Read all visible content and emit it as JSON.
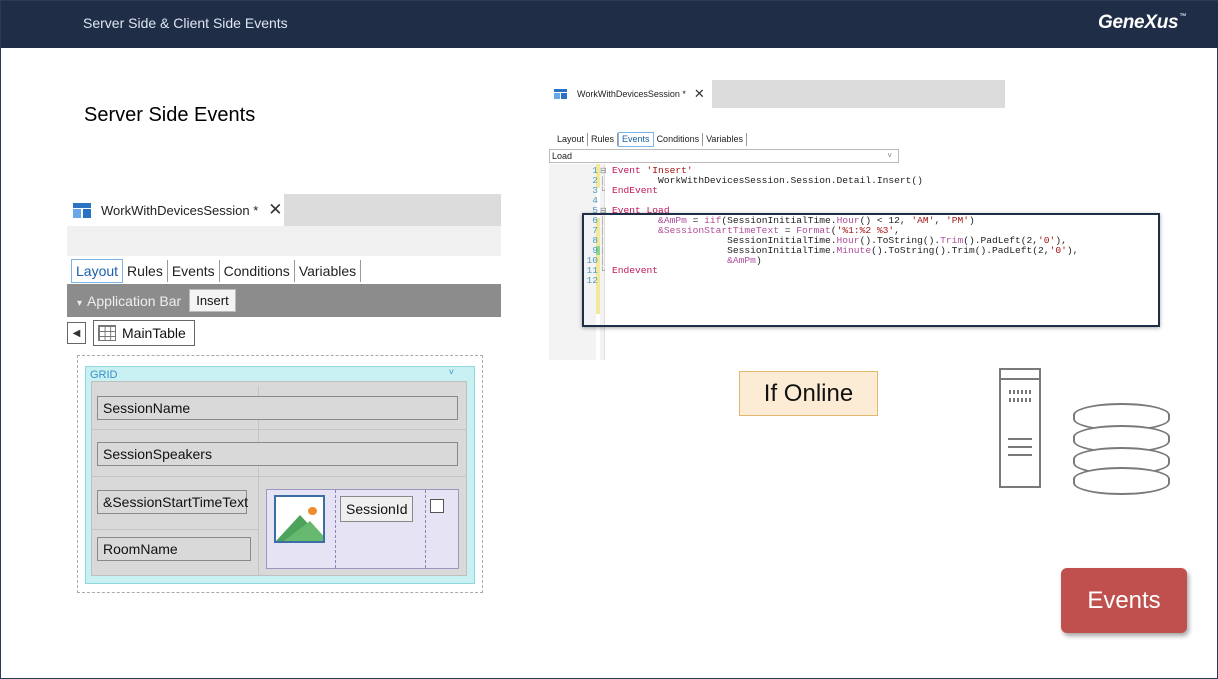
{
  "slide": {
    "header_title": "Server Side & Client Side Events",
    "logo_text": "GeneXus",
    "logo_mark": "™",
    "heading": "Server Side Events",
    "if_online_label": "If Online",
    "events_badge": "Events",
    "colors": {
      "header_bg": "#1f2d47",
      "badge_bg": "#c0504d",
      "note_bg": "#fcecd6"
    }
  },
  "layout_editor": {
    "doc_tab": "WorkWithDevicesSession *",
    "close_glyph": "✕",
    "tabs": [
      "Layout",
      "Rules",
      "Events",
      "Conditions",
      "Variables"
    ],
    "active_tab": "Layout",
    "application_bar_label": "Application Bar",
    "application_bar_caret": "▾",
    "insert_button": "Insert",
    "back_glyph": "◀",
    "breadcrumb": "MainTable",
    "grid_label": "GRID",
    "grid_caret": "˅",
    "fields": {
      "session_name": "SessionName",
      "session_speakers": "SessionSpeakers",
      "start_time_text": "&SessionStartTimeText",
      "room_name": "RoomName",
      "session_id": "SessionId"
    }
  },
  "events_editor": {
    "doc_tab": "WorkWithDevicesSession *",
    "close_glyph": "✕",
    "tabs": [
      "Layout",
      "Rules",
      "Events",
      "Conditions",
      "Variables"
    ],
    "active_tab": "Events",
    "event_dropdown_value": "Load",
    "dropdown_caret": "˅",
    "code_lines": [
      {
        "n": "1",
        "fold": "⊟",
        "parts": [
          [
            "kw",
            "Event "
          ],
          [
            "str",
            "'Insert'"
          ]
        ]
      },
      {
        "n": "2",
        "fold": "│",
        "parts": [
          [
            "txt",
            "        WorkWithDevicesSession.Session.Detail.Insert()"
          ]
        ]
      },
      {
        "n": "3",
        "fold": "└",
        "parts": [
          [
            "kw",
            "EndEvent"
          ]
        ]
      },
      {
        "n": "4",
        "fold": "",
        "parts": []
      },
      {
        "n": "5",
        "fold": "⊟",
        "parts": [
          [
            "kw",
            "Event "
          ],
          [
            "kw",
            "Load"
          ]
        ]
      },
      {
        "n": "6",
        "fold": "│",
        "parts": [
          [
            "var",
            "        &AmPm"
          ],
          [
            "txt",
            " = "
          ],
          [
            "fn",
            "iif"
          ],
          [
            "txt",
            "(SessionInitialTime."
          ],
          [
            "fn",
            "Hour"
          ],
          [
            "txt",
            "() < 12, "
          ],
          [
            "str",
            "'AM'"
          ],
          [
            "txt",
            ", "
          ],
          [
            "str",
            "'PM'"
          ],
          [
            "txt",
            ")"
          ]
        ]
      },
      {
        "n": "7",
        "fold": "│",
        "parts": [
          [
            "var",
            "        &SessionStartTimeText"
          ],
          [
            "txt",
            " = "
          ],
          [
            "fn",
            "Format"
          ],
          [
            "txt",
            "("
          ],
          [
            "str",
            "'%1:%2 %3'"
          ],
          [
            "txt",
            ","
          ]
        ]
      },
      {
        "n": "8",
        "fold": "│",
        "parts": [
          [
            "txt",
            "                    SessionInitialTime."
          ],
          [
            "fn",
            "Hour"
          ],
          [
            "txt",
            "().ToString()."
          ],
          [
            "fn",
            "Trim"
          ],
          [
            "txt",
            "().PadLeft(2,"
          ],
          [
            "str",
            "'0'"
          ],
          [
            "txt",
            "),"
          ]
        ]
      },
      {
        "n": "9",
        "fold": "│",
        "parts": [
          [
            "txt",
            "                    SessionInitialTime."
          ],
          [
            "fn",
            "Minute"
          ],
          [
            "txt",
            "().ToString().Trim().PadLeft(2,"
          ],
          [
            "str",
            "'0'"
          ],
          [
            "txt",
            "),"
          ]
        ]
      },
      {
        "n": "10",
        "fold": "│",
        "parts": [
          [
            "var",
            "                    &AmPm"
          ],
          [
            "txt",
            ")"
          ]
        ]
      },
      {
        "n": "11",
        "fold": "└",
        "parts": [
          [
            "kw",
            "Endevent"
          ]
        ]
      },
      {
        "n": "12",
        "fold": "",
        "parts": []
      }
    ]
  }
}
